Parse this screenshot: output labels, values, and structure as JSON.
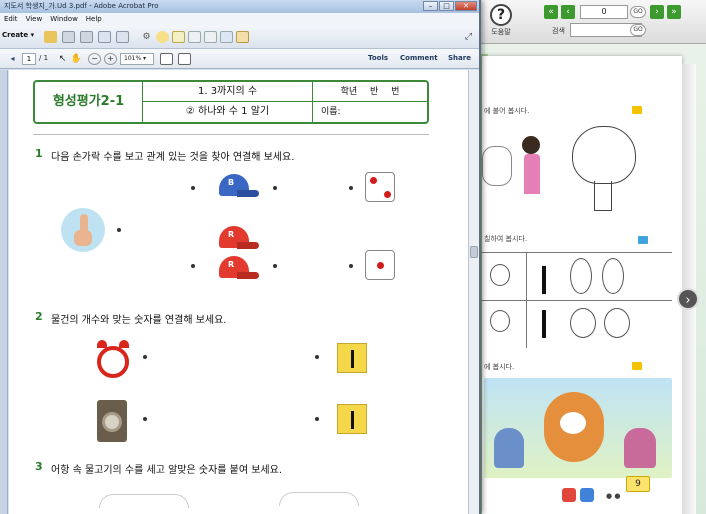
{
  "background_app": {
    "toolbar_icons": [
      "pencil-icon",
      "highlighter-icon",
      "text-icon",
      "eraser-icon",
      "shape-icon"
    ],
    "help_label": "도움말",
    "page_input": "0",
    "go_label": "GO",
    "search_label": "검색",
    "book": {
      "text_1": "에 불어 봅시다.",
      "text_2": "칠하여 봅시다.",
      "text_3": "에 봅시다.",
      "page_number": "9",
      "page_dots": "● ●"
    }
  },
  "acrobat": {
    "title": "지도서 학생지_가.Ud 3.pdf - Adobe Acrobat Pro",
    "window_buttons": [
      "–",
      "□",
      "✕"
    ],
    "menu": [
      "Edit",
      "View",
      "Window",
      "Help"
    ],
    "create_label": "Create ▾",
    "page_current": "1",
    "page_total": "/ 1",
    "zoom": "101% ▾",
    "tabs": [
      "Tools",
      "Comment",
      "Share"
    ]
  },
  "worksheet": {
    "title": "형성평가2-1",
    "chapter": "1. 3까지의 수",
    "lesson": "② 하나와 수 1 알기",
    "grade_line": "학년 반 번",
    "name_label": "이름:",
    "questions": [
      {
        "number": "1",
        "text": "다음 손가락 수를 보고 관계 있는 것을 찾아 연결해 보세요."
      },
      {
        "number": "2",
        "text": "물건의 개수와 맞는 숫자를 연결해 보세요."
      },
      {
        "number": "3",
        "text": "어항 속 물고기의 수를 세고 알맞은 숫자를 붙여 보세요."
      }
    ],
    "cap_letters": [
      "B",
      "R",
      "R"
    ]
  }
}
